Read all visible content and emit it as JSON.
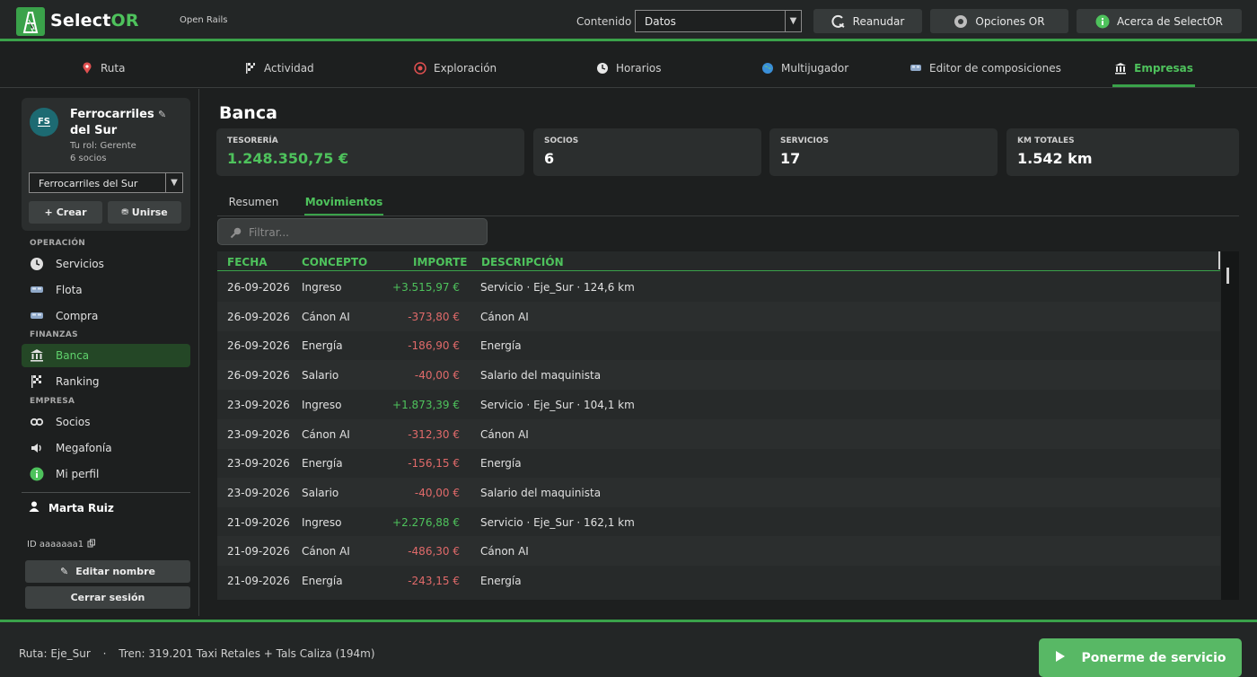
{
  "app": {
    "brand_prefix": "Select",
    "brand_suffix": "OR",
    "subtitle": "Open Rails"
  },
  "header": {
    "content_label": "Contenido",
    "content_select": {
      "value": "Datos"
    },
    "buttons": [
      {
        "label": "Reanudar",
        "icon": "resume-icon"
      },
      {
        "label": "Opciones OR",
        "icon": "gear-icon"
      },
      {
        "label": "Acerca de SelectOR",
        "icon": "info-icon"
      }
    ]
  },
  "tabs": [
    {
      "label": "Ruta",
      "icon": "map-pin-icon"
    },
    {
      "label": "Actividad",
      "icon": "flag-icon"
    },
    {
      "label": "Exploración",
      "icon": "compass-icon"
    },
    {
      "label": "Horarios",
      "icon": "clock-icon"
    },
    {
      "label": "Multijugador",
      "icon": "globe-icon"
    },
    {
      "label": "Editor de composiciones",
      "icon": "train-icon"
    },
    {
      "label": "Empresas",
      "icon": "bank-icon",
      "active": true
    }
  ],
  "sidebar": {
    "company": {
      "initials": "FS",
      "name": "Ferrocarriles del Sur",
      "role": "Tu rol: Gerente",
      "members": "6 socios",
      "select_value": "Ferrocarriles del Sur",
      "create_label": "Crear",
      "join_label": "Unirse"
    },
    "sections": [
      {
        "label": "OPERACIÓN"
      },
      {
        "label": "FINANZAS"
      },
      {
        "label": "EMPRESA"
      }
    ],
    "items": [
      {
        "label": "Servicios",
        "icon": "clock-icon"
      },
      {
        "label": "Flota",
        "icon": "train-icon"
      },
      {
        "label": "Compra",
        "icon": "train-icon"
      },
      {
        "label": "Banca",
        "icon": "bank-icon",
        "active": true
      },
      {
        "label": "Ranking",
        "icon": "checkered-flag-icon"
      },
      {
        "label": "Socios",
        "icon": "link-icon"
      },
      {
        "label": "Megafonía",
        "icon": "speaker-icon"
      },
      {
        "label": "Mi perfil",
        "icon": "info-icon"
      }
    ],
    "user": {
      "name": "Marta Ruiz",
      "id": "ID aaaaaaa1"
    },
    "edit_name_label": "Editar nombre",
    "logout_label": "Cerrar sesión"
  },
  "main": {
    "title": "Banca",
    "stats": [
      {
        "label": "TESORERÍA",
        "value": "1.248.350,75 €",
        "highlight": true
      },
      {
        "label": "SOCIOS",
        "value": "6"
      },
      {
        "label": "SERVICIOS",
        "value": "17"
      },
      {
        "label": "KM TOTALES",
        "value": "1.542 km"
      }
    ],
    "subtabs": [
      {
        "label": "Resumen"
      },
      {
        "label": "Movimientos",
        "active": true
      }
    ],
    "filter_placeholder": "Filtrar...",
    "table": {
      "headers": [
        "FECHA",
        "CONCEPTO",
        "IMPORTE",
        "DESCRIPCIÓN"
      ],
      "rows": [
        {
          "fecha": "26-09-2026",
          "concepto": "Ingreso",
          "importe": "+3.515,97 €",
          "sign": "pos",
          "descripcion": "Servicio · Eje_Sur · 124,6 km"
        },
        {
          "fecha": "26-09-2026",
          "concepto": "Cánon AI",
          "importe": "-373,80 €",
          "sign": "neg",
          "descripcion": "Cánon AI"
        },
        {
          "fecha": "26-09-2026",
          "concepto": "Energía",
          "importe": "-186,90 €",
          "sign": "neg",
          "descripcion": "Energía"
        },
        {
          "fecha": "26-09-2026",
          "concepto": "Salario",
          "importe": "-40,00 €",
          "sign": "neg",
          "descripcion": "Salario del maquinista"
        },
        {
          "fecha": "23-09-2026",
          "concepto": "Ingreso",
          "importe": "+1.873,39 €",
          "sign": "pos",
          "descripcion": "Servicio · Eje_Sur · 104,1 km"
        },
        {
          "fecha": "23-09-2026",
          "concepto": "Cánon AI",
          "importe": "-312,30 €",
          "sign": "neg",
          "descripcion": "Cánon AI"
        },
        {
          "fecha": "23-09-2026",
          "concepto": "Energía",
          "importe": "-156,15 €",
          "sign": "neg",
          "descripcion": "Energía"
        },
        {
          "fecha": "23-09-2026",
          "concepto": "Salario",
          "importe": "-40,00 €",
          "sign": "neg",
          "descripcion": "Salario del maquinista"
        },
        {
          "fecha": "21-09-2026",
          "concepto": "Ingreso",
          "importe": "+2.276,88 €",
          "sign": "pos",
          "descripcion": "Servicio · Eje_Sur · 162,1 km"
        },
        {
          "fecha": "21-09-2026",
          "concepto": "Cánon AI",
          "importe": "-486,30 €",
          "sign": "neg",
          "descripcion": "Cánon AI"
        },
        {
          "fecha": "21-09-2026",
          "concepto": "Energía",
          "importe": "-243,15 €",
          "sign": "neg",
          "descripcion": "Energía"
        }
      ]
    }
  },
  "footer": {
    "route": "Ruta: Eje_Sur",
    "separator": "·",
    "train": "Tren: 319.201 Taxi Retales + Tals Caliza (194m)",
    "cta_label": "Ponerme de servicio"
  },
  "colors": {
    "accent": "#3aa24a",
    "positive": "#4ec25c",
    "negative": "#e06a6a"
  }
}
